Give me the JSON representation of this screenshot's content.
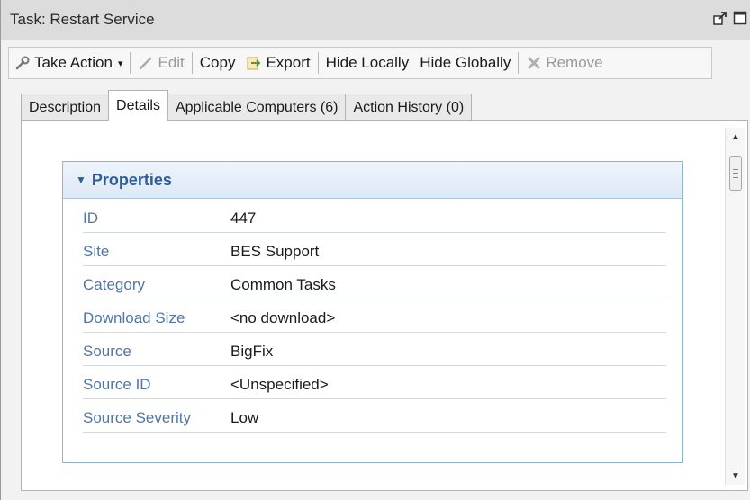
{
  "window": {
    "title": "Task: Restart Service"
  },
  "toolbar": {
    "take_action": "Take Action",
    "edit": "Edit",
    "copy": "Copy",
    "export": "Export",
    "hide_locally": "Hide Locally",
    "hide_globally": "Hide Globally",
    "remove": "Remove"
  },
  "tabs": [
    {
      "label": "Description"
    },
    {
      "label": "Details"
    },
    {
      "label": "Applicable Computers (6)"
    },
    {
      "label": "Action History (0)"
    }
  ],
  "properties": {
    "header": "Properties",
    "rows": [
      {
        "key": "ID",
        "value": "447"
      },
      {
        "key": "Site",
        "value": "BES Support"
      },
      {
        "key": "Category",
        "value": "Common Tasks"
      },
      {
        "key": "Download Size",
        "value": "<no download>"
      },
      {
        "key": "Source",
        "value": "BigFix"
      },
      {
        "key": "Source ID",
        "value": "<Unspecified>"
      },
      {
        "key": "Source Severity",
        "value": "Low"
      }
    ]
  },
  "icons": {
    "take_action": "wrench-icon",
    "edit": "pencil-icon",
    "export": "export-icon",
    "remove": "remove-x-icon",
    "undock": "undock-icon",
    "maximize": "maximize-icon"
  },
  "colors": {
    "accent": "#2f5f96",
    "label": "#5076a8",
    "box_border": "#8fb4d8"
  }
}
